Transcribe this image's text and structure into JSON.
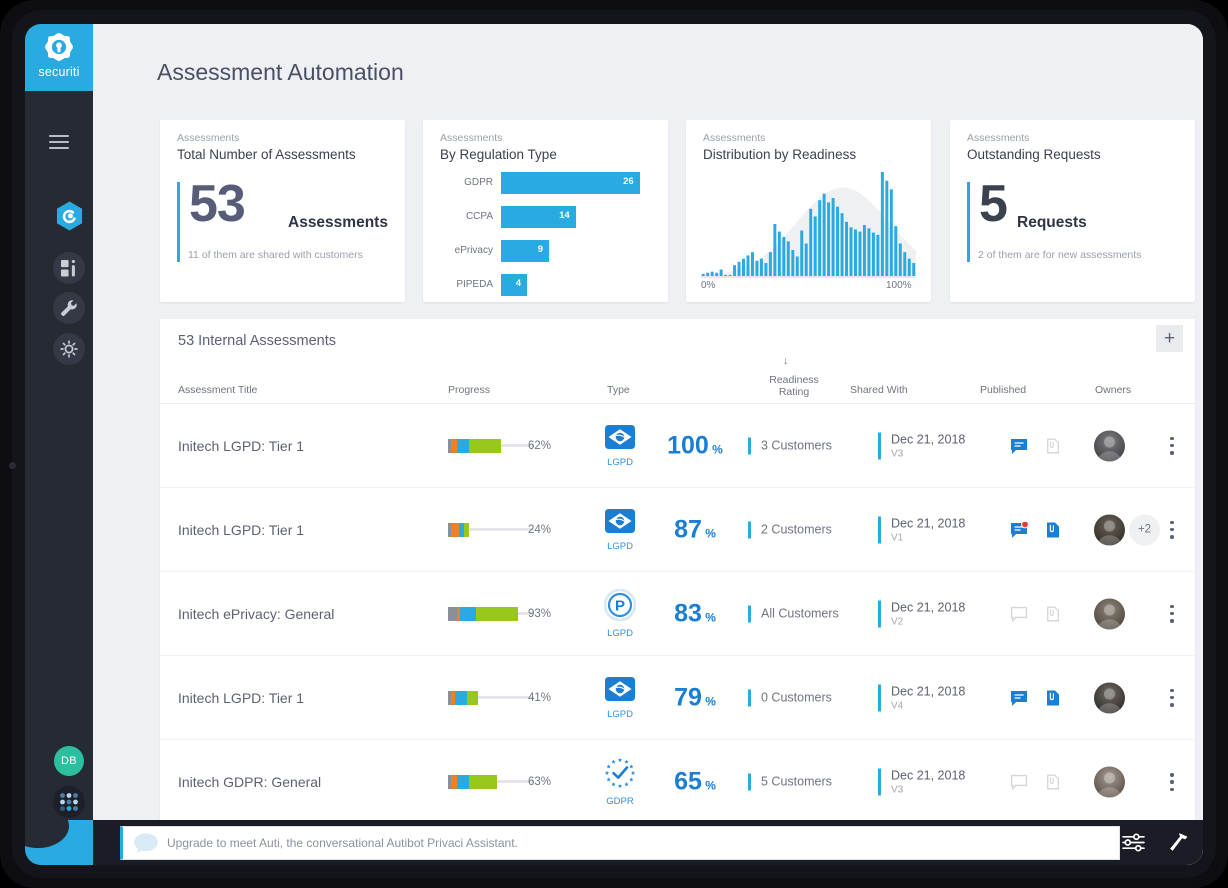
{
  "brand": {
    "name": "securiti",
    "logo_icon": "securiti-logo-icon"
  },
  "sidebar": {
    "menu_icon": "hamburger-menu-icon",
    "items": [
      {
        "icon": "privacy-hexagon-icon",
        "name": "privaci-module"
      },
      {
        "icon": "dashboard-grid-icon",
        "name": "data-intelligence"
      },
      {
        "icon": "wrench-icon",
        "name": "tools"
      },
      {
        "icon": "gear-icon",
        "name": "settings"
      }
    ],
    "user_initials": "DB",
    "apps_icon": "apps-grid-icon"
  },
  "header": {
    "title": "Assessment Automation"
  },
  "cards": [
    {
      "eyebrow": "Assessments",
      "title": "Total Number of Assessments",
      "value": "53",
      "unit": "Assessments",
      "sub": "11 of them are shared with customers",
      "value_color": "#575c78"
    },
    {
      "eyebrow": "Assessments",
      "title": "By Regulation Type"
    },
    {
      "eyebrow": "Assessments",
      "title": "Distribution by Readiness",
      "axis_min": "0%",
      "axis_max": "100%"
    },
    {
      "eyebrow": "Assessments",
      "title": "Outstanding Requests",
      "value": "5",
      "unit": "Requests",
      "sub": "2 of them are for new assessments",
      "value_color": "#3c414f"
    }
  ],
  "chart_data": [
    {
      "type": "bar",
      "title": "By Regulation Type",
      "orientation": "horizontal",
      "categories": [
        "GDPR",
        "CCPA",
        "ePrivacy",
        "PIPEDA"
      ],
      "values": [
        26,
        14,
        9,
        4
      ],
      "xlabel": "",
      "ylabel": "",
      "xlim": [
        0,
        30
      ],
      "grid": false,
      "legend": "none",
      "bar_color": "#29abe2",
      "value_labels": [
        "26",
        "14",
        "9",
        "4"
      ]
    },
    {
      "type": "bar",
      "title": "Distribution by Readiness",
      "subtitle": "Histogram of assessments by readiness percentage with normal-curve overlay",
      "xlabel": "",
      "ylabel": "",
      "xlim": [
        0,
        100
      ],
      "tick_labels": [
        "0%",
        "100%"
      ],
      "grid": false,
      "legend": "none",
      "bar_color": "#29abe2",
      "curve_color": "#eef0f2",
      "x": [
        6,
        8,
        10,
        12,
        14,
        16,
        18,
        20,
        22,
        24,
        26,
        28,
        30,
        32,
        34,
        36,
        38,
        40,
        42,
        44,
        46,
        48,
        50,
        52,
        54,
        56,
        58,
        60,
        62,
        64,
        66,
        68,
        70,
        72,
        74,
        76,
        78,
        80,
        82,
        84,
        86,
        88,
        90,
        92,
        94,
        96,
        98,
        100
      ],
      "values": [
        2,
        3,
        4,
        3,
        6,
        1,
        1,
        10,
        13,
        16,
        19,
        22,
        14,
        16,
        12,
        22,
        48,
        41,
        36,
        32,
        24,
        18,
        42,
        30,
        62,
        55,
        70,
        76,
        68,
        72,
        64,
        58,
        50,
        45,
        43,
        41,
        47,
        44,
        40,
        38,
        96,
        88,
        80,
        46,
        30,
        22,
        16,
        12
      ]
    }
  ],
  "table": {
    "title": "53 Internal Assessments",
    "add_label": "+",
    "sort_indicator": "↓",
    "columns": [
      {
        "label": "Assessment Title",
        "name": "assessment-title"
      },
      {
        "label": "Progress",
        "name": "progress"
      },
      {
        "label": "Type",
        "name": "type"
      },
      {
        "label": "Readiness",
        "label2": "Rating",
        "name": "readiness-rating"
      },
      {
        "label": "Shared With",
        "name": "shared-with"
      },
      {
        "label": "Published",
        "name": "published"
      },
      {
        "label": "Owners",
        "name": "owners"
      }
    ],
    "rows": [
      {
        "title": "Initech LGPD: Tier 1",
        "progress_pct": "62%",
        "progress_value": 62,
        "segments": [
          {
            "color": "#8a9099",
            "w": 4
          },
          {
            "color": "#f08122",
            "w": 6
          },
          {
            "color": "#29abe2",
            "w": 14
          },
          {
            "color": "#9ac71c",
            "w": 38
          }
        ],
        "type_icon": "brazil-flag-icon",
        "type_label": "LGPD",
        "readiness": "100",
        "readiness_unit": "%",
        "shared_with": "3 Customers",
        "published_date": "Dec 21, 2018",
        "published_version": "V3",
        "comment_state": "active",
        "comment_badge": false,
        "doc_state": "inactive",
        "owner_extra": "",
        "avatar_gradient": [
          "#7d7d82",
          "#3b3b40"
        ]
      },
      {
        "title": "Initech LGPD: Tier 1",
        "progress_pct": "24%",
        "progress_value": 24,
        "segments": [
          {
            "color": "#8a9099",
            "w": 3
          },
          {
            "color": "#f08122",
            "w": 10
          },
          {
            "color": "#29abe2",
            "w": 6
          },
          {
            "color": "#9ac71c",
            "w": 5
          }
        ],
        "type_icon": "brazil-flag-icon",
        "type_label": "LGPD",
        "readiness": "87",
        "readiness_unit": "%",
        "shared_with": "2 Customers",
        "published_date": "Dec 21, 2018",
        "published_version": "V1",
        "comment_state": "active",
        "comment_badge": true,
        "doc_state": "active",
        "owner_extra": "+2",
        "avatar_gradient": [
          "#6b6358",
          "#2e2a25"
        ]
      },
      {
        "title": "Initech ePrivacy: General",
        "progress_pct": "93%",
        "progress_value": 93,
        "segments": [
          {
            "color": "#8a9099",
            "w": 10
          },
          {
            "color": "#f08122",
            "w": 4
          },
          {
            "color": "#29abe2",
            "w": 18
          },
          {
            "color": "#9ac71c",
            "w": 49
          }
        ],
        "type_icon": "privacy-p-circle-icon",
        "type_label": "LGPD",
        "readiness": "83",
        "readiness_unit": "%",
        "shared_with": "All Customers",
        "published_date": "Dec 21, 2018",
        "published_version": "V2",
        "comment_state": "inactive",
        "comment_badge": false,
        "doc_state": "inactive",
        "owner_extra": "",
        "avatar_gradient": [
          "#8e8578",
          "#4a4239"
        ]
      },
      {
        "title": "Initech LGPD: Tier 1",
        "progress_pct": "41%",
        "progress_value": 41,
        "segments": [
          {
            "color": "#8a9099",
            "w": 4
          },
          {
            "color": "#f08122",
            "w": 4
          },
          {
            "color": "#29abe2",
            "w": 14
          },
          {
            "color": "#9ac71c",
            "w": 13
          }
        ],
        "type_icon": "brazil-flag-icon",
        "type_label": "LGPD",
        "readiness": "79",
        "readiness_unit": "%",
        "shared_with": "0 Customers",
        "published_date": "Dec 21, 2018",
        "published_version": "V4",
        "comment_state": "active",
        "comment_badge": false,
        "doc_state": "active",
        "owner_extra": "",
        "avatar_gradient": [
          "#6f6a66",
          "#2b2825"
        ]
      },
      {
        "title": "Initech GDPR: General",
        "progress_pct": "63%",
        "progress_value": 63,
        "segments": [
          {
            "color": "#8a9099",
            "w": 4
          },
          {
            "color": "#f08122",
            "w": 7
          },
          {
            "color": "#29abe2",
            "w": 14
          },
          {
            "color": "#9ac71c",
            "w": 32
          }
        ],
        "type_icon": "gdpr-stars-check-icon",
        "type_label": "GDPR",
        "readiness": "65",
        "readiness_unit": "%",
        "shared_with": "5 Customers",
        "published_date": "Dec 21, 2018",
        "published_version": "V3",
        "comment_state": "inactive",
        "comment_badge": false,
        "doc_state": "inactive",
        "owner_extra": "",
        "avatar_gradient": [
          "#a79c92",
          "#554b43"
        ]
      }
    ]
  },
  "bottom": {
    "chat_placeholder": "Upgrade to meet Auti, the conversational Autibot Privaci Assistant.",
    "chat_icon": "speech-bubble-icon",
    "icons": [
      {
        "name": "search-icon",
        "glyph": "search"
      },
      {
        "name": "filter-sliders-icon",
        "glyph": "sliders"
      },
      {
        "name": "hammer-tool-icon",
        "glyph": "hammer"
      }
    ]
  },
  "colors": {
    "accent": "#29abe2",
    "readiness": "#1a7fd4",
    "sidebar": "#262a33",
    "page_bg": "#eef0f3"
  }
}
